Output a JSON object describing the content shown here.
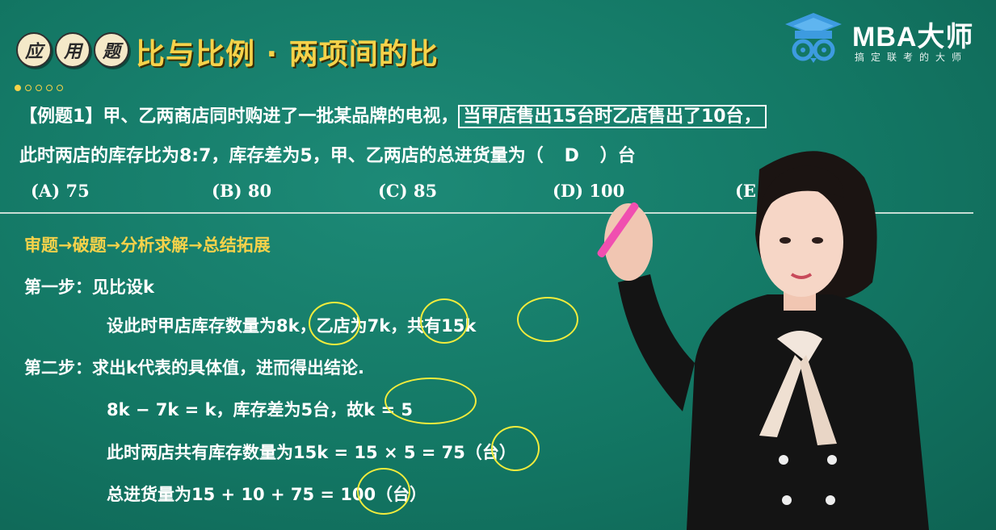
{
  "header": {
    "badge_chars": [
      "应",
      "用",
      "题"
    ],
    "title": "比与比例 · 两项间的比"
  },
  "logo": {
    "name": "MBA大师",
    "slogan": "搞定联考的大师"
  },
  "problem": {
    "tag": "【例题1】",
    "line1_text": "甲、乙两商店同时购进了一批某品牌的电视，",
    "line1_boxed": "当甲店售出15台时乙店售出了10台，",
    "line2_text": "此时两店的库存比为8:7，库存差为5，甲、乙两店的总进货量为（",
    "answer": "D",
    "line2_end": "）台",
    "options": [
      "(A) 75",
      "(B) 80",
      "(C) 85",
      "(D) 100",
      "(E"
    ]
  },
  "solution": {
    "flow": "审题→破题→分析求解→总结拓展",
    "step1_label": "第一步：",
    "step1_title": "见比设k",
    "step1_line": "设此时甲店库存数量为8k，乙店为7k，共有15k",
    "step2_label": "第二步：",
    "step2_title": "求出k代表的具体值，进而得出结论.",
    "step2_line1": "8k − 7k = k，库存差为5台，故k = 5",
    "step2_line2": "此时两店共有库存数量为15k = 15 × 5 = 75（台）",
    "step2_line3": "总进货量为15 + 10 + 75 = 100（台）"
  },
  "colors": {
    "board": "#137764",
    "title": "#f6d24a",
    "annotation": "#f2ec3c"
  }
}
